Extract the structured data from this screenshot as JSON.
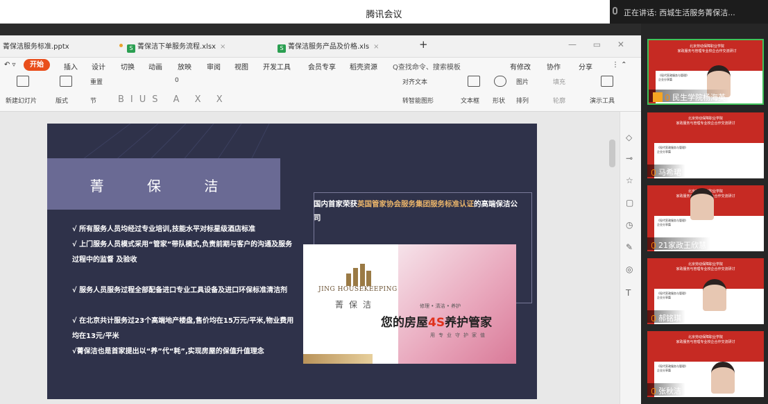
{
  "meeting": {
    "title": "腾讯会议",
    "speaking": "正在讲话: 西城生活服务菁保洁..."
  },
  "tabs": [
    {
      "label": "菁保洁服务标准.pptx"
    },
    {
      "label": "菁保洁下单服务流程.xlsx"
    },
    {
      "label": "菁保洁服务产品及价格.xls"
    }
  ],
  "tab_add": "+",
  "menu": {
    "start": "开始",
    "items": [
      "插入",
      "设计",
      "切换",
      "动画",
      "放映",
      "审阅",
      "视图",
      "开发工具",
      "会员专享",
      "稻壳资源"
    ],
    "search": "查找命令、搜索模板",
    "right": [
      "有修改",
      "协作",
      "分享"
    ]
  },
  "ribbon": {
    "new_slide": "新建幻灯片",
    "layout": "版式",
    "section": "节",
    "reset": "重置",
    "font_size": "0",
    "align_text": "对齐文本",
    "smart_shape": "转智能图形",
    "textbox": "文本框",
    "shape": "形状",
    "picture": "图片",
    "arrange": "排列",
    "fill": "填充",
    "outline": "轮廓",
    "present": "演示工具"
  },
  "slide": {
    "brand": "菁 保 洁",
    "bullets": [
      "√ 所有服务人员均经过专业培训,技能水平对标星级酒店标准",
      "√ 上门服务人员模式采用“管家”带队模式,负责前期与客户的沟通及服务过程中的监督 及验收",
      "√ 服务人员服务过程全部配备进口专业工具设备及进口环保标准清洁剂",
      "√ 在北京共计服务过23个高端地产楼盘,售价均在15万元/平米,物业费用均在13元/平米",
      "√菁保洁也是首家提出以“养”代“耗”,实现房屋的保值升值理念"
    ],
    "cert_pre": "国内首家荣获",
    "cert_hl": "英国管家协会服务集团服务标准认证",
    "cert_post": "的高端保洁公司",
    "logo_en": "JING HOUSEKEEPING",
    "logo_cn": "菁保洁",
    "tagline": "修理 • 清洁 • 养护",
    "slogan_pre": "您的房屋",
    "slogan_hl": "4S",
    "slogan_post": "养护管家",
    "sub": "用专业守护家值"
  },
  "participants": [
    {
      "name": "民生学院杨海英",
      "active": true
    },
    {
      "name": "马希珺",
      "active": false
    },
    {
      "name": "21家政王欣慧",
      "active": false
    },
    {
      "name": "郝铭琪",
      "active": false
    },
    {
      "name": "张秋洁",
      "active": false
    }
  ],
  "video_header": "北京劳动保障职业学院\n家政服务与管理专业校企合作交流研讨",
  "video_sub": "《现代家政服务与管理》\n企业分享篇",
  "colors": {
    "accent": "#e94e1b",
    "slide_bg": "#2f324a",
    "brand_box": "#6a6a94",
    "highlight": "#e8b36a",
    "video_red": "#c62a23",
    "active_border": "#3fc45a"
  }
}
